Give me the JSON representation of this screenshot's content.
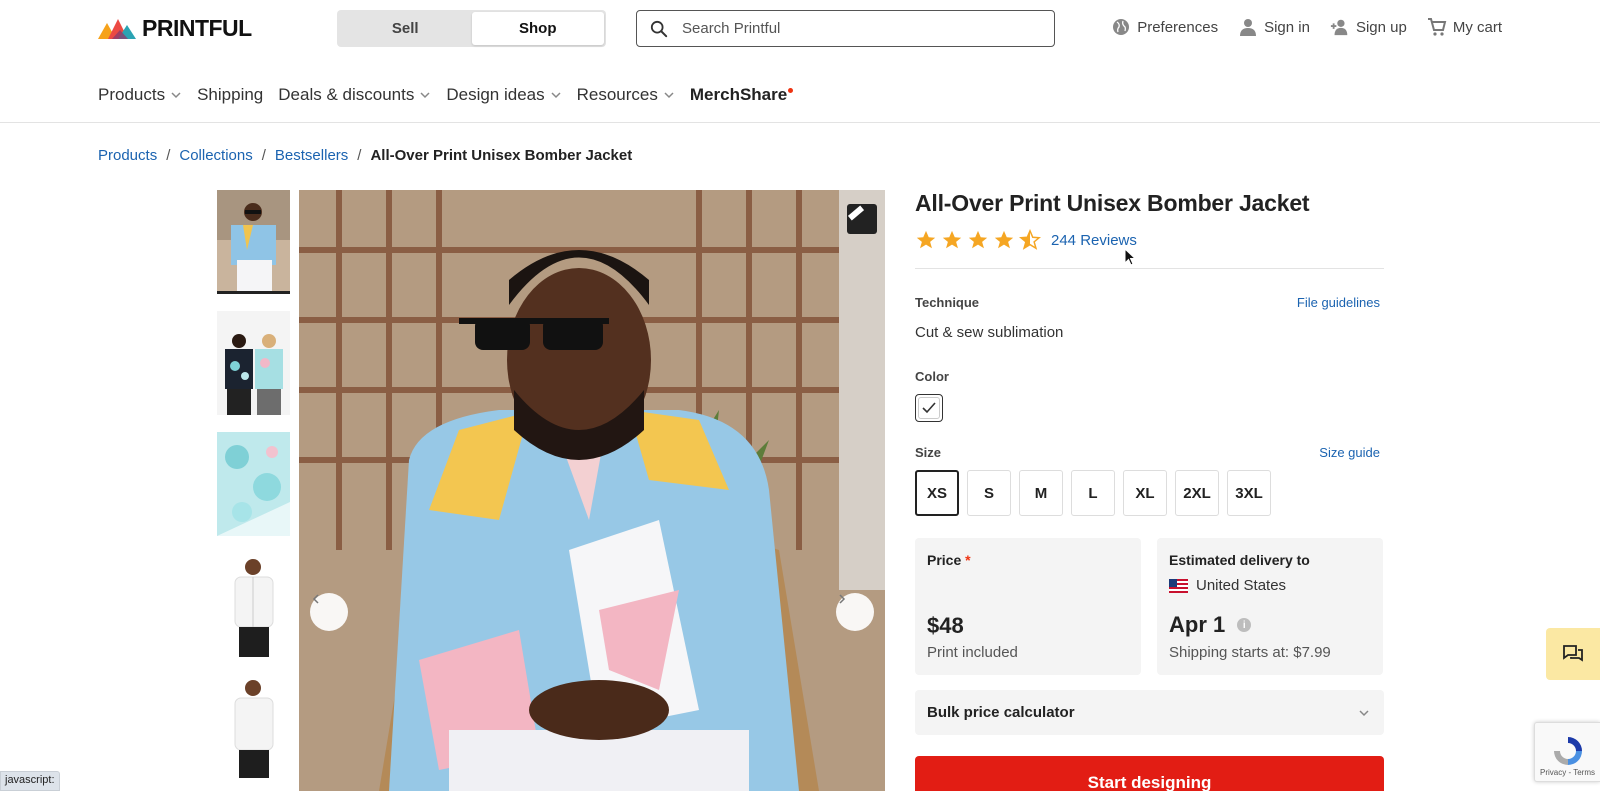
{
  "brand": {
    "name": "PRINTFUL"
  },
  "mode_switch": {
    "sell": "Sell",
    "shop": "Shop",
    "active": "Shop"
  },
  "search": {
    "placeholder": "Search Printful",
    "value": ""
  },
  "user_links": {
    "preferences": "Preferences",
    "sign_in": "Sign in",
    "sign_up": "Sign up",
    "cart": "My cart"
  },
  "nav": {
    "products": "Products",
    "shipping": "Shipping",
    "deals": "Deals & discounts",
    "design_ideas": "Design ideas",
    "resources": "Resources",
    "merchshare": "MerchShare"
  },
  "breadcrumb": {
    "items": [
      "Products",
      "Collections",
      "Bestsellers"
    ],
    "separator": "/",
    "current": "All-Over Print Unisex Bomber Jacket"
  },
  "product": {
    "title": "All-Over Print Unisex Bomber Jacket",
    "rating": 4.5,
    "rating_max": 5,
    "reviews": "244 Reviews",
    "technique_label": "Technique",
    "file_guidelines": "File guidelines",
    "technique": "Cut & sew sublimation",
    "color_label": "Color",
    "size_label": "Size",
    "size_guide": "Size guide",
    "sizes": [
      "XS",
      "S",
      "M",
      "L",
      "XL",
      "2XL",
      "3XL"
    ],
    "selected_size": "XS",
    "price_label": "Price",
    "price_required_mark": "*",
    "price": "$48",
    "price_note": "Print included",
    "delivery_label": "Estimated delivery to",
    "delivery_country": "United States",
    "delivery_date": "Apr 1",
    "shipping_note": "Shipping starts at: $7.99",
    "bulk_calculator": "Bulk price calculator",
    "cta": "Start designing"
  },
  "recaptcha": {
    "text": "Privacy - Terms"
  },
  "status_bar": {
    "text": "javascript:"
  },
  "colors": {
    "link": "#1b63b0",
    "cta": "#e21d14",
    "star": "#f5a623",
    "card_bg": "#f4f4f4",
    "chat_widget": "#fbe8a3"
  }
}
